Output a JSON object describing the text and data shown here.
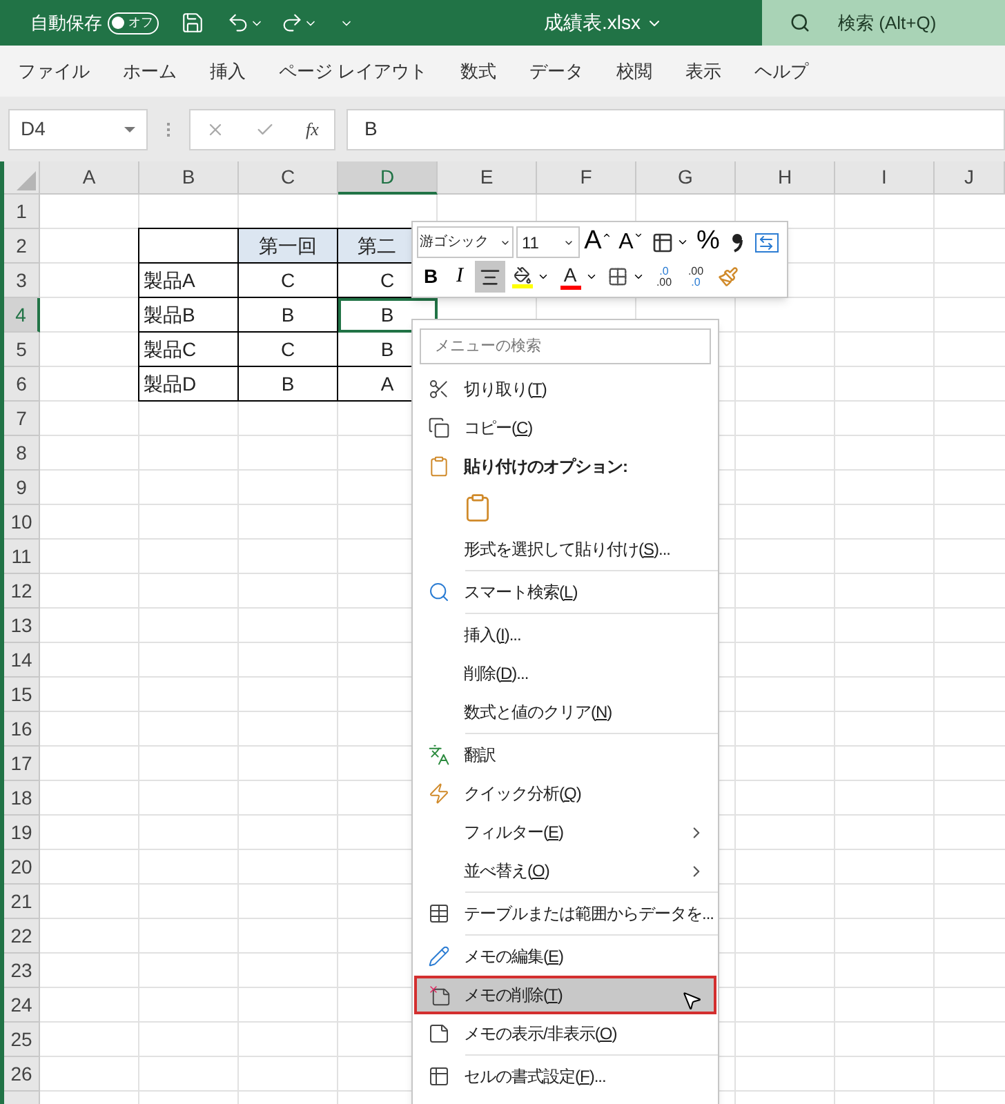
{
  "title_bar": {
    "autosave_label": "自動保存",
    "autosave_toggle": {
      "label": "オフ",
      "on": false
    },
    "file_title": "成績表.xlsx",
    "search_placeholder": "検索 (Alt+Q)"
  },
  "ribbon_tabs": [
    {
      "label": "ファイル",
      "selected": false
    },
    {
      "label": "ホーム",
      "selected": false
    },
    {
      "label": "挿入",
      "selected": false
    },
    {
      "label": "ページ レイアウト",
      "selected": false
    },
    {
      "label": "数式",
      "selected": false
    },
    {
      "label": "データ",
      "selected": false
    },
    {
      "label": "校閲",
      "selected": false
    },
    {
      "label": "表示",
      "selected": false
    },
    {
      "label": "ヘルプ",
      "selected": false
    }
  ],
  "formula_bar": {
    "name_box": "D4",
    "function_label": "fx",
    "value": "B"
  },
  "sheet": {
    "columns": [
      {
        "label": "A",
        "selected": false
      },
      {
        "label": "B",
        "selected": false
      },
      {
        "label": "C",
        "selected": false
      },
      {
        "label": "D",
        "selected": true
      },
      {
        "label": "E",
        "selected": false
      },
      {
        "label": "F",
        "selected": false
      },
      {
        "label": "G",
        "selected": false
      },
      {
        "label": "H",
        "selected": false
      },
      {
        "label": "I",
        "selected": false
      },
      {
        "label": "J",
        "selected": false
      }
    ],
    "rows": [
      {
        "label": "1",
        "selected": false
      },
      {
        "label": "2",
        "selected": false
      },
      {
        "label": "3",
        "selected": false
      },
      {
        "label": "4",
        "selected": true
      },
      {
        "label": "5",
        "selected": false
      },
      {
        "label": "6",
        "selected": false
      },
      {
        "label": "7",
        "selected": false
      },
      {
        "label": "8",
        "selected": false
      },
      {
        "label": "9",
        "selected": false
      },
      {
        "label": "10",
        "selected": false
      },
      {
        "label": "11",
        "selected": false
      },
      {
        "label": "12",
        "selected": false
      },
      {
        "label": "13",
        "selected": false
      },
      {
        "label": "14",
        "selected": false
      },
      {
        "label": "15",
        "selected": false
      },
      {
        "label": "16",
        "selected": false
      },
      {
        "label": "17",
        "selected": false
      },
      {
        "label": "18",
        "selected": false
      },
      {
        "label": "19",
        "selected": false
      },
      {
        "label": "20",
        "selected": false
      },
      {
        "label": "21",
        "selected": false
      },
      {
        "label": "22",
        "selected": false
      },
      {
        "label": "23",
        "selected": false
      },
      {
        "label": "24",
        "selected": false
      },
      {
        "label": "25",
        "selected": false
      },
      {
        "label": "26",
        "selected": false
      }
    ],
    "table": [
      [
        {
          "kind": "blank",
          "selected": false
        },
        {
          "kind": "header",
          "text": "第一回",
          "selected": false
        },
        {
          "kind": "header-cut",
          "text": "第二",
          "selected": false
        }
      ],
      [
        {
          "kind": "label",
          "text": "製品A",
          "selected": false
        },
        {
          "kind": "value",
          "text": "C",
          "selected": false
        },
        {
          "kind": "value",
          "text": "C",
          "selected": false
        }
      ],
      [
        {
          "kind": "label",
          "text": "製品B",
          "selected": false
        },
        {
          "kind": "value",
          "text": "B",
          "selected": false
        },
        {
          "kind": "value",
          "text": "B",
          "selected": true
        }
      ],
      [
        {
          "kind": "label",
          "text": "製品C",
          "selected": false
        },
        {
          "kind": "value",
          "text": "C",
          "selected": false
        },
        {
          "kind": "value",
          "text": "B",
          "selected": false
        }
      ],
      [
        {
          "kind": "label",
          "text": "製品D",
          "selected": false
        },
        {
          "kind": "value",
          "text": "B",
          "selected": false
        },
        {
          "kind": "value",
          "text": "A",
          "selected": false
        }
      ]
    ]
  },
  "mini_toolbar": {
    "font": "游ゴシック",
    "size": "11",
    "row1": [
      {
        "kind": "grow-font",
        "glyph": "A",
        "selected": false
      },
      {
        "kind": "shrink-font",
        "glyph": "A",
        "selected": false
      },
      {
        "kind": "cell-style",
        "selected": false
      },
      {
        "kind": "percent",
        "glyph": "%",
        "selected": false
      },
      {
        "kind": "comma",
        "selected": false
      },
      {
        "kind": "merge",
        "selected": false
      }
    ],
    "row2": [
      {
        "kind": "bold",
        "glyph": "B",
        "selected": false
      },
      {
        "kind": "italic",
        "glyph": "I",
        "selected": false
      },
      {
        "kind": "center",
        "selected": true
      },
      {
        "kind": "fill-color",
        "selected": false
      },
      {
        "kind": "font-color",
        "glyph": "A",
        "selected": false
      },
      {
        "kind": "borders",
        "selected": false
      },
      {
        "kind": "inc-decimal",
        "top": ".0",
        "bottom": ".00",
        "selected": false
      },
      {
        "kind": "dec-decimal",
        "top": ".00",
        "bottom": ".0",
        "selected": false
      },
      {
        "kind": "painter",
        "selected": false
      }
    ]
  },
  "context_menu": {
    "search_placeholder": "メニューの検索",
    "items": [
      {
        "kind": "cut",
        "label": "切り取り(",
        "key": "T",
        "suffix": ")",
        "selected": false
      },
      {
        "kind": "copy",
        "label": "コピー(",
        "key": "C",
        "suffix": ")",
        "selected": false
      },
      {
        "kind": "paste-header",
        "label": "貼り付けのオプション:",
        "selected": false
      },
      {
        "kind": "paste-icon",
        "selected": false
      },
      {
        "kind": "plain",
        "label": "形式を選択して貼り付け(",
        "key": "S",
        "suffix": ")...",
        "selected": false
      },
      {
        "kind": "separator"
      },
      {
        "kind": "smart-lookup",
        "label": "スマート検索(",
        "key": "L",
        "suffix": ")",
        "selected": false
      },
      {
        "kind": "separator"
      },
      {
        "kind": "plain",
        "label": "挿入(",
        "key": "I",
        "suffix": ")...",
        "selected": false
      },
      {
        "kind": "plain",
        "label": "削除(",
        "key": "D",
        "suffix": ")...",
        "selected": false
      },
      {
        "kind": "plain",
        "label": "数式と値のクリア(",
        "key": "N",
        "suffix": ")",
        "selected": false
      },
      {
        "kind": "separator"
      },
      {
        "kind": "translate",
        "label": "翻訳",
        "selected": false
      },
      {
        "kind": "quick-analysis",
        "label": "クイック分析(",
        "key": "Q",
        "suffix": ")",
        "selected": false
      },
      {
        "kind": "submenu",
        "label": "フィルター(",
        "key": "E",
        "suffix": ")",
        "selected": false
      },
      {
        "kind": "submenu",
        "label": "並べ替え(",
        "key": "O",
        "suffix": ")",
        "selected": false
      },
      {
        "kind": "separator"
      },
      {
        "kind": "table",
        "label": "テーブルまたは範囲からデータを...",
        "selected": false
      },
      {
        "kind": "separator"
      },
      {
        "kind": "edit-note",
        "label": "メモの編集(",
        "key": "E",
        "suffix": ")",
        "selected": false
      },
      {
        "kind": "delete-note",
        "label": "メモの削除(",
        "key": "T",
        "suffix": ")",
        "selected": true
      },
      {
        "kind": "show-note",
        "label": "メモの表示/非表示(",
        "key": "O",
        "suffix": ")",
        "selected": false
      },
      {
        "kind": "separator"
      },
      {
        "kind": "format-cells",
        "label": "セルの書式設定(",
        "key": "F",
        "suffix": ")...",
        "selected": false
      }
    ]
  }
}
